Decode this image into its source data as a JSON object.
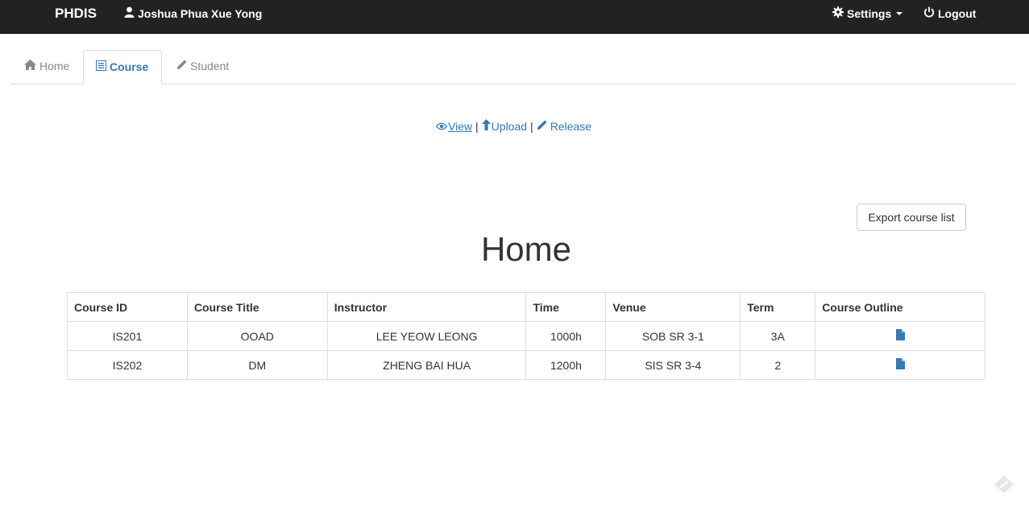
{
  "navbar": {
    "brand": "PHDIS",
    "user_name": "Joshua Phua Xue Yong",
    "user_icon": "user-icon",
    "settings_label": "Settings",
    "settings_icon": "gear-icon",
    "logout_label": "Logout",
    "logout_icon": "power-icon"
  },
  "tabs": [
    {
      "label": "Home",
      "icon": "home-icon"
    },
    {
      "label": "Course",
      "icon": "list-icon",
      "active": true
    },
    {
      "label": "Student",
      "icon": "pencil-icon"
    }
  ],
  "subnav": {
    "view_label": "View",
    "upload_label": "Upload",
    "release_label": "Release",
    "separator": "|"
  },
  "export_button_label": "Export course list",
  "page_heading": "Home",
  "table": {
    "headers": [
      "Course ID",
      "Course Title",
      "Instructor",
      "Time",
      "Venue",
      "Term",
      "Course Outline"
    ],
    "rows": [
      {
        "course_id": "IS201",
        "title": "OOAD",
        "instructor": "LEE YEOW LEONG",
        "time": "1000h",
        "venue": "SOB SR 3-1",
        "term": "3A",
        "outline_icon": "file-icon"
      },
      {
        "course_id": "IS202",
        "title": "DM",
        "instructor": "ZHENG BAI HUA",
        "time": "1200h",
        "venue": "SIS SR 3-4",
        "term": "2",
        "outline_icon": "file-icon"
      }
    ]
  },
  "colors": {
    "navbar_bg": "#222222",
    "link": "#337ab7",
    "muted": "#888888",
    "border": "#dddddd"
  }
}
